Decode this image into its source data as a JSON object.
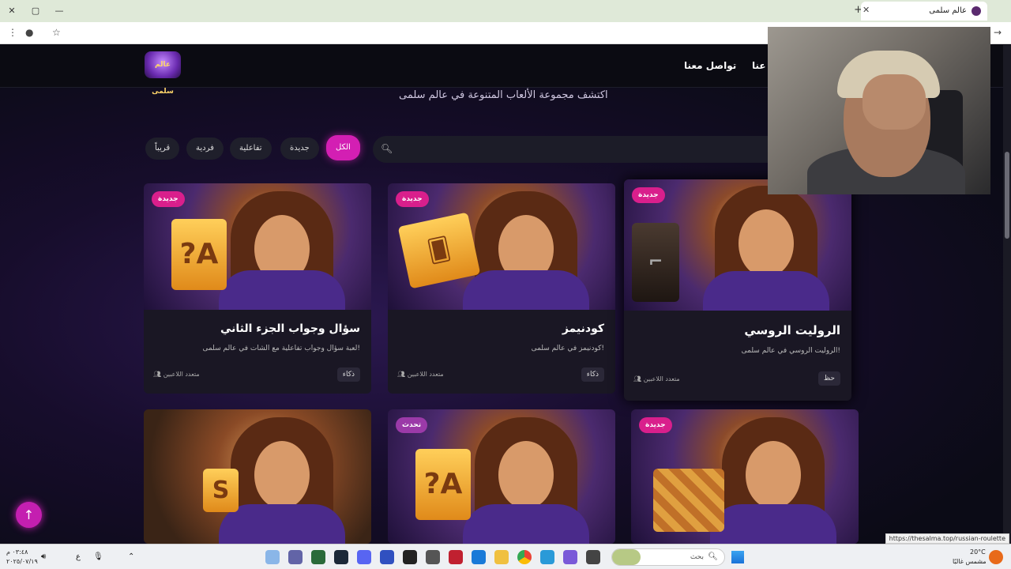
{
  "browser": {
    "tab_title": "عالم سلمى",
    "new_tab": "+",
    "tab_close": "✕",
    "status_url": "https://thesalma.top/russian-roulette"
  },
  "nav": {
    "logo_text": "عالم سلمى",
    "links": [
      "تواصل معنا",
      "عنا"
    ]
  },
  "hero": {
    "subtitle": "اكتشف مجموعة الألعاب المتنوعة في عالم سلمى"
  },
  "filters": {
    "items": [
      "الكل",
      "جديدة",
      "تفاعلية",
      "فردية",
      "قريباً"
    ],
    "active": "الكل",
    "search_placeholder": ""
  },
  "games": [
    {
      "title": "الروليت الروسي",
      "desc": "الروليت الروسي في عالم سلمى!",
      "badge": "جديدة",
      "tag": "حظ",
      "players": "متعدد اللاعبين",
      "prop": "gun"
    },
    {
      "title": "كودنيمز",
      "desc": "كودنيمز في عالم سلمى!",
      "badge": "جديدة",
      "tag": "ذكاء",
      "players": "متعدد اللاعبين",
      "prop": "cards"
    },
    {
      "title": "سؤال وجواب الجزء الثاني",
      "desc": "لعبة سؤال وجواب تفاعلية مع الشات في عالم سلمى!",
      "badge": "جديدة",
      "tag": "ذكاء",
      "players": "متعدد اللاعبين",
      "prop": "?A"
    },
    {
      "badge": "جديدة",
      "prop": "board"
    },
    {
      "badge": "تحدث",
      "prop": "?A"
    },
    {
      "badge": "",
      "prop": "S"
    }
  ],
  "taskbar": {
    "search_label": "بحث",
    "weather_temp": "20°C",
    "weather_desc": "مشمس غالبًا",
    "time": "٠٣:٤٨ م",
    "date": "٢٠٢٥/٠٧/١٩",
    "lang": "ع"
  },
  "colors": {
    "accent": "#d31fb3",
    "badge_new": "#d91f8c",
    "badge_talk": "#9b3aa8"
  }
}
